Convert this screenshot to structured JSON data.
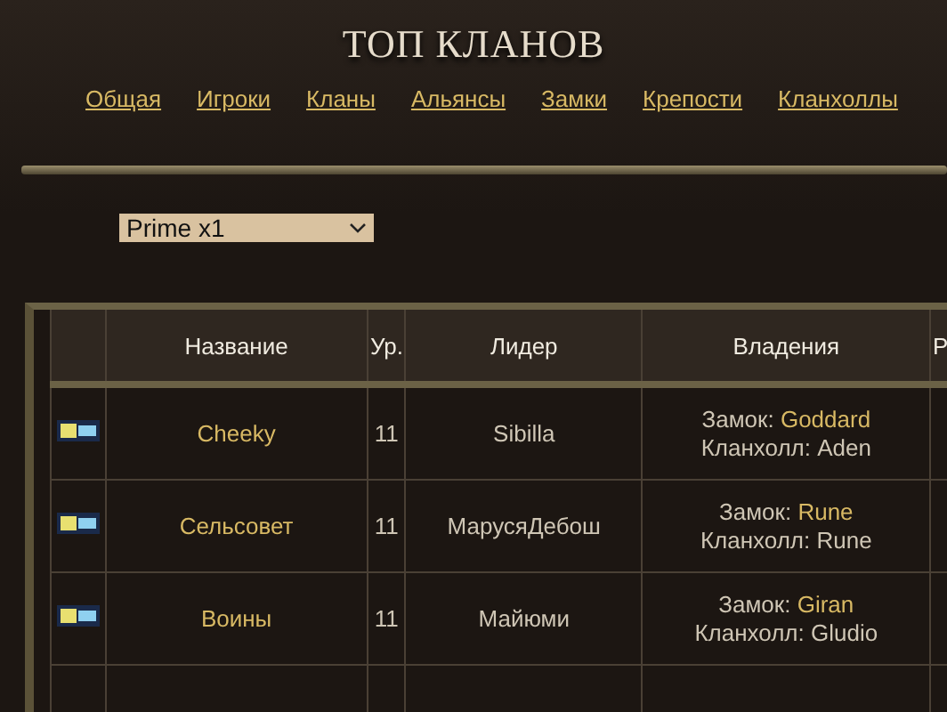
{
  "title": "ТОП КЛАНОВ",
  "nav": [
    {
      "label": "Общая"
    },
    {
      "label": "Игроки"
    },
    {
      "label": "Кланы"
    },
    {
      "label": "Альянсы"
    },
    {
      "label": "Замки"
    },
    {
      "label": "Крепости"
    },
    {
      "label": "Кланхоллы"
    }
  ],
  "server_select": {
    "value": "Prime x1"
  },
  "table": {
    "columns": [
      "Название",
      "Ур.",
      "Лидер",
      "Владения",
      "Р"
    ],
    "rows": [
      {
        "name": "Cheeky",
        "level": "11",
        "leader": "Sibilla",
        "castle_label": "Замок:",
        "castle": "Goddard",
        "hall_label": "Кланхолл:",
        "hall": "Aden"
      },
      {
        "name": "Сельсовет",
        "level": "11",
        "leader": "МарусяДебош",
        "castle_label": "Замок:",
        "castle": "Rune",
        "hall_label": "Кланхолл:",
        "hall": "Rune"
      },
      {
        "name": "Воины",
        "level": "11",
        "leader": "Майюми",
        "castle_label": "Замок:",
        "castle": "Giran",
        "hall_label": "Кланхолл:",
        "hall": "Gludio"
      }
    ]
  }
}
